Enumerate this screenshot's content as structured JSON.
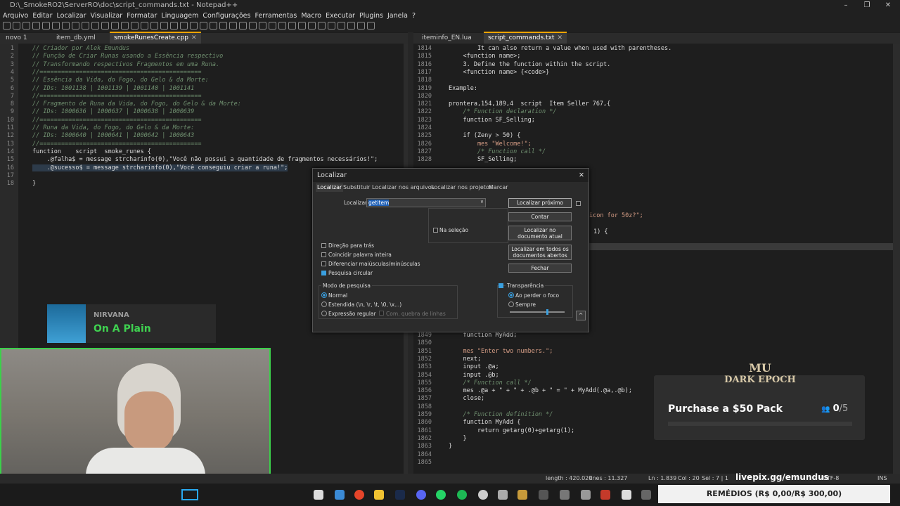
{
  "window": {
    "title": "D:\\_SmokeRO2\\ServerRO\\doc\\script_commands.txt - Notepad++"
  },
  "menu": [
    "Arquivo",
    "Editar",
    "Localizar",
    "Visualizar",
    "Formatar",
    "Linguagem",
    "Configurações",
    "Ferramentas",
    "Macro",
    "Executar",
    "Plugins",
    "Janela",
    "?"
  ],
  "left_tabs": [
    "novo 1",
    "item_db.yml",
    "smokeRunesCreate.cpp"
  ],
  "right_tabs": [
    "iteminfo_EN.lua",
    "script_commands.txt"
  ],
  "left_lines": [
    {
      "n": "1",
      "t": "// Criador por Alek Emundus",
      "c": "cm"
    },
    {
      "n": "2",
      "t": "// Função de Criar Runas usando a Essência respectivo",
      "c": "cm"
    },
    {
      "n": "3",
      "t": "// Transformando respectivos Fragmentos em uma Runa.",
      "c": "cm"
    },
    {
      "n": "4",
      "t": "//=============================================",
      "c": "cm"
    },
    {
      "n": "5",
      "t": "// Essência da Vida, do Fogo, do Gelo & da Morte:",
      "c": "cm"
    },
    {
      "n": "6",
      "t": "// IDs: 1001138 | 1001139 | 1001140 | 1001141",
      "c": "cm"
    },
    {
      "n": "7",
      "t": "//=============================================",
      "c": "cm"
    },
    {
      "n": "8",
      "t": "// Fragmento de Runa da Vida, do Fogo, do Gelo & da Morte:",
      "c": "cm"
    },
    {
      "n": "9",
      "t": "// IDs: 1000636 | 1000637 | 1000638 | 1000639",
      "c": "cm"
    },
    {
      "n": "10",
      "t": "//=============================================",
      "c": "cm"
    },
    {
      "n": "11",
      "t": "// Runa da Vida, do Fogo, do Gelo & da Morte:",
      "c": "cm"
    },
    {
      "n": "12",
      "t": "// IDs: 1000640 | 1000641 | 1000642 | 1000643",
      "c": "cm"
    },
    {
      "n": "13",
      "t": "//=============================================",
      "c": "cm"
    },
    {
      "n": "14",
      "t": "function    script  smoke_runes {",
      "c": "kw"
    },
    {
      "n": "15",
      "t": "    .@falha$ = message strcharinfo(0),\"Você não possui a quantidade de fragmentos necessários!\";",
      "c": "kw"
    },
    {
      "n": "16",
      "t": "    .@sucesso$ = message strcharinfo(0),\"Você conseguiu criar a runa!\";",
      "c": "kw"
    },
    {
      "n": "17",
      "t": "",
      "c": "kw"
    },
    {
      "n": "18",
      "t": "}",
      "c": "kw"
    }
  ],
  "right_top": [
    {
      "n": "1814",
      "t": "        It can also return a value when used with parentheses.",
      "c": "kw"
    },
    {
      "n": "1815",
      "t": "    <function name>;",
      "c": "kw"
    },
    {
      "n": "1816",
      "t": "    3. Define the function within the script.",
      "c": "kw"
    },
    {
      "n": "1817",
      "t": "    <function name> {<code>}",
      "c": "kw"
    },
    {
      "n": "1818",
      "t": "",
      "c": "kw"
    },
    {
      "n": "1819",
      "t": "Example:",
      "c": "kw"
    },
    {
      "n": "1820",
      "t": "",
      "c": "kw"
    },
    {
      "n": "1821",
      "t": "prontera,154,189,4  script  Item Seller 767,{",
      "c": "kw"
    },
    {
      "n": "1822",
      "t": "    /* Function declaration */",
      "c": "cm"
    },
    {
      "n": "1823",
      "t": "    function SF_Selling;",
      "c": "kw"
    },
    {
      "n": "1824",
      "t": "",
      "c": "kw"
    },
    {
      "n": "1825",
      "t": "    if (Zeny > 50) {",
      "c": "kw"
    },
    {
      "n": "1826",
      "t": "        mes \"Welcome!\";",
      "c": "str"
    },
    {
      "n": "1827",
      "t": "        /* Function call */",
      "c": "cm"
    },
    {
      "n": "1828",
      "t": "        SF_Selling;",
      "c": "kw"
    }
  ],
  "right_mid_fragments": [
    "icon for 50z?\";",
    "1) {"
  ],
  "right_bottom": [
    {
      "n": "1849",
      "t": "    function MyAdd;",
      "c": "kw"
    },
    {
      "n": "1850",
      "t": "",
      "c": "kw"
    },
    {
      "n": "1851",
      "t": "    mes \"Enter two numbers.\";",
      "c": "str"
    },
    {
      "n": "1852",
      "t": "    next;",
      "c": "kw"
    },
    {
      "n": "1853",
      "t": "    input .@a;",
      "c": "kw"
    },
    {
      "n": "1854",
      "t": "    input .@b;",
      "c": "kw"
    },
    {
      "n": "1855",
      "t": "    /* Function call */",
      "c": "cm"
    },
    {
      "n": "1856",
      "t": "    mes .@a + \" + \" + .@b + \" = \" + MyAdd(.@a,.@b);",
      "c": "kw"
    },
    {
      "n": "1857",
      "t": "    close;",
      "c": "kw"
    },
    {
      "n": "1858",
      "t": "",
      "c": "kw"
    },
    {
      "n": "1859",
      "t": "    /* Function definition */",
      "c": "cm"
    },
    {
      "n": "1860",
      "t": "    function MyAdd {",
      "c": "kw"
    },
    {
      "n": "1861",
      "t": "        return getarg(0)+getarg(1);",
      "c": "kw"
    },
    {
      "n": "1862",
      "t": "    }",
      "c": "kw"
    },
    {
      "n": "1863",
      "t": "}",
      "c": "kw"
    },
    {
      "n": "1864",
      "t": "",
      "c": "kw"
    },
    {
      "n": "1865",
      "t": "",
      "c": "kw"
    }
  ],
  "find_dialog": {
    "title": "Localizar",
    "tabs": [
      "Localizar",
      "Substituir",
      "Localizar nos arquivos",
      "Localizar nos projetos",
      "Marcar"
    ],
    "find_label": "Localizar:",
    "find_value": "getitem",
    "find_next": "Localizar próximo",
    "count": "Contar",
    "find_in_doc": "Localizar no documento atual",
    "find_all_open": "Localizar em todos os documentos abertos",
    "close": "Fechar",
    "in_selection": "Na seleção",
    "options": [
      {
        "label": "Direção para trás",
        "checked": false
      },
      {
        "label": "Coincidir palavra inteira",
        "checked": false
      },
      {
        "label": "Diferenciar maiúsculas/minúsculas",
        "checked": false
      },
      {
        "label": "Pesquisa circular",
        "checked": true
      }
    ],
    "search_mode_title": "Modo de pesquisa",
    "modes": [
      "Normal",
      "Estendida  (\\n, \\r, \\t, \\0, \\x...)",
      "Expressão regular"
    ],
    "dot_newline": "Com. quebra de linhas",
    "transparency": "Transparência",
    "trans_options": [
      "Ao perder o foco",
      "Sempre"
    ]
  },
  "now_playing": {
    "artist": "NIRVANA",
    "track": "On A Plain"
  },
  "promo": {
    "logo_line1": "MU",
    "logo_line2": "DARK EPOCH",
    "text": "Purchase a $50 Pack",
    "count": "0",
    "total": "/5",
    "progress": 0
  },
  "livepix": "livepix.gg/emundus",
  "statusbar": {
    "length": "length : 420.020",
    "lines": "lines : 11.327",
    "ln": "Ln : 1.839",
    "col": "Col : 20",
    "sel": "Sel : 7 | 1",
    "encoding": "UTF-8",
    "mode": "INS"
  },
  "remedios": "REMÉDIOS (R$ 0,00/R$ 300,00)",
  "colors": {
    "accent": "#f0a400",
    "green_border": "#3bd14a",
    "highlight": "#3aa0e0"
  }
}
